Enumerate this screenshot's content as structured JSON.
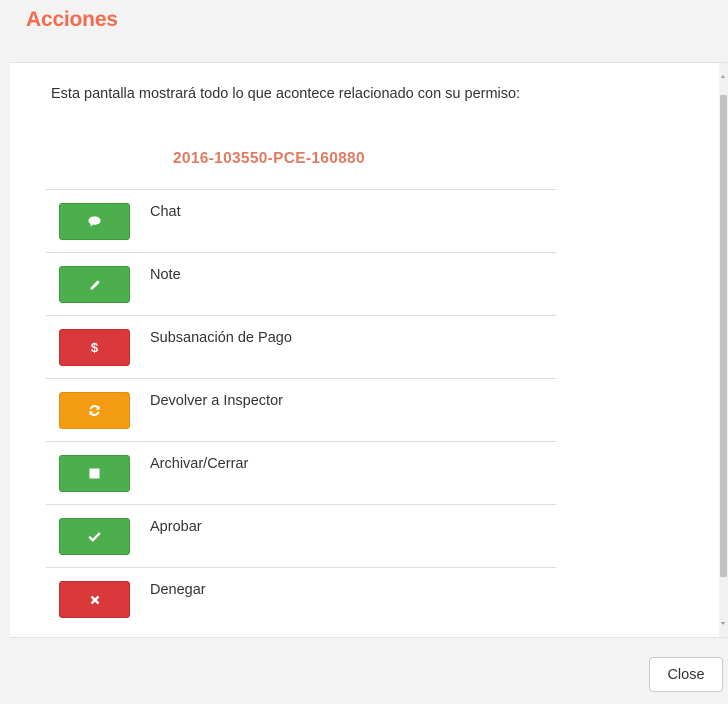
{
  "dialog": {
    "title": "Acciones",
    "intro": "Esta pantalla mostrará todo lo que acontece relacionado con su permiso:",
    "permit_id": "2016-103550-PCE-160880",
    "close_label": "Close"
  },
  "actions": [
    {
      "label": "Chat",
      "icon": "chat-icon",
      "color": "#4cae4c"
    },
    {
      "label": "Note",
      "icon": "pencil-icon",
      "color": "#4cae4c"
    },
    {
      "label": "Subsanación de Pago",
      "icon": "dollar-icon",
      "icon_text": "$",
      "color": "#d9393a"
    },
    {
      "label": "Devolver a Inspector",
      "icon": "refresh-icon",
      "color": "#f39c12"
    },
    {
      "label": "Archivar/Cerrar",
      "icon": "stop-icon",
      "color": "#4cae4c"
    },
    {
      "label": "Aprobar",
      "icon": "check-icon",
      "color": "#4cae4c"
    },
    {
      "label": "Denegar",
      "icon": "close-icon",
      "color": "#d9393a"
    }
  ]
}
